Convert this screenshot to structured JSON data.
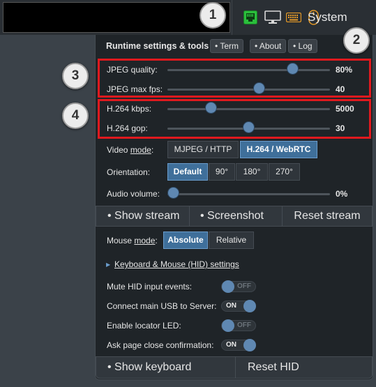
{
  "topbar": {
    "system_label": "System",
    "icons": [
      "ethernet-icon",
      "monitor-icon",
      "keyboard-icon",
      "mouse-icon"
    ],
    "accent_green": "#2bbf3c",
    "accent_orange": "#e59a27"
  },
  "markers": [
    "1",
    "2",
    "3",
    "4"
  ],
  "header": {
    "title": "Runtime settings & tools",
    "term": "• Term",
    "about": "• About",
    "log": "• Log"
  },
  "sliders": [
    {
      "label": "JPEG quality:",
      "value": "80%",
      "level": 0.8
    },
    {
      "label": "JPEG max fps:",
      "value": "40",
      "level": 0.57
    },
    {
      "label": "H.264 kbps:",
      "value": "5000",
      "level": 0.26
    },
    {
      "label": "H.264 gop:",
      "value": "30",
      "level": 0.5
    }
  ],
  "video_mode": {
    "label_prefix": "Video ",
    "label_underlined": "mode",
    "label_suffix": ":",
    "options": [
      "MJPEG / HTTP",
      "H.264 / WebRTC"
    ],
    "selected": "H.264 / WebRTC"
  },
  "orientation": {
    "label": "Orientation:",
    "options": [
      "Default",
      "90°",
      "180°",
      "270°"
    ],
    "selected": "Default"
  },
  "audio": {
    "label": "Audio volume:",
    "value": "0%",
    "level": 0.0
  },
  "stream_buttons": [
    "• Show stream",
    "• Screenshot",
    "Reset stream"
  ],
  "mouse_mode": {
    "label_prefix": "Mouse ",
    "label_underlined": "mode",
    "label_suffix": ":",
    "options": [
      "Absolute",
      "Relative"
    ],
    "selected": "Absolute"
  },
  "hid_settings_link": "Keyboard & Mouse (HID) settings",
  "toggles": [
    {
      "label": "Mute HID input events:",
      "state": "OFF"
    },
    {
      "label": "Connect main USB to Server:",
      "state": "ON"
    },
    {
      "label": "Enable locator LED:",
      "state": "OFF"
    },
    {
      "label": "Ask page close confirmation:",
      "state": "ON"
    }
  ],
  "bottom_buttons": [
    "• Show keyboard",
    "Reset HID"
  ],
  "highlight_color": "#e0191e"
}
